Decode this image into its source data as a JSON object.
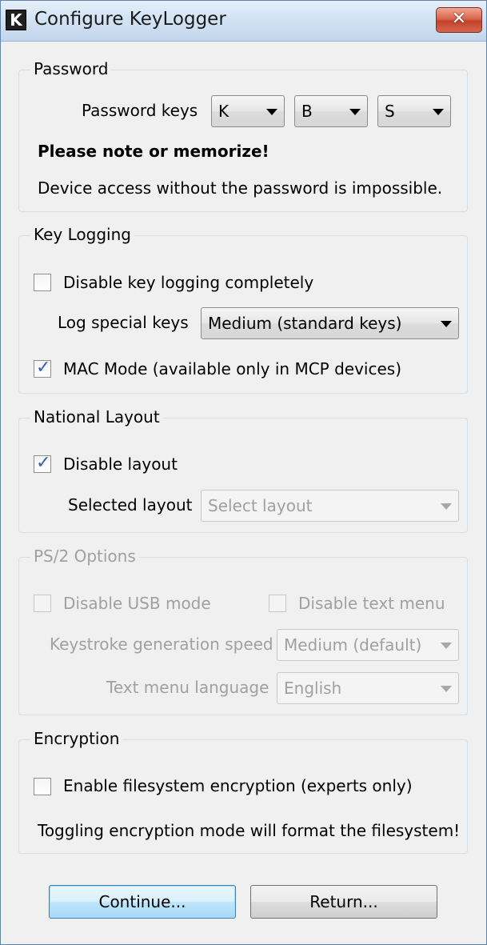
{
  "window": {
    "title": "Configure KeyLogger",
    "app_icon_letter": "K",
    "close_glyph": "✕"
  },
  "password": {
    "legend": "Password",
    "keys_label": "Password keys",
    "keys": [
      "K",
      "B",
      "S"
    ],
    "note": "Please note or memorize!",
    "warning": "Device access without the password is impossible."
  },
  "key_logging": {
    "legend": "Key Logging",
    "disable_label": "Disable key logging completely",
    "disable_checked": false,
    "special_keys_label": "Log special keys",
    "special_keys_value": "Medium (standard keys)",
    "mac_mode_label": "MAC Mode (available only in MCP devices)",
    "mac_mode_checked": true
  },
  "national_layout": {
    "legend": "National Layout",
    "disable_label": "Disable layout",
    "disable_checked": true,
    "selected_label": "Selected layout",
    "selected_value": "Select layout"
  },
  "ps2": {
    "legend": "PS/2 Options",
    "disable_usb_label": "Disable USB mode",
    "disable_text_menu_label": "Disable text menu",
    "speed_label": "Keystroke generation speed",
    "speed_value": "Medium (default)",
    "language_label": "Text menu language",
    "language_value": "English"
  },
  "encryption": {
    "legend": "Encryption",
    "enable_label": "Enable filesystem encryption (experts only)",
    "enable_checked": false,
    "warning": "Toggling encryption mode will format the filesystem!"
  },
  "buttons": {
    "continue": "Continue...",
    "return": "Return..."
  },
  "colors": {
    "title_bar": "#d3e3f3",
    "close_button": "#c4412b",
    "check_mark": "#3b5fa8",
    "disabled_text": "#a0a0a0"
  }
}
